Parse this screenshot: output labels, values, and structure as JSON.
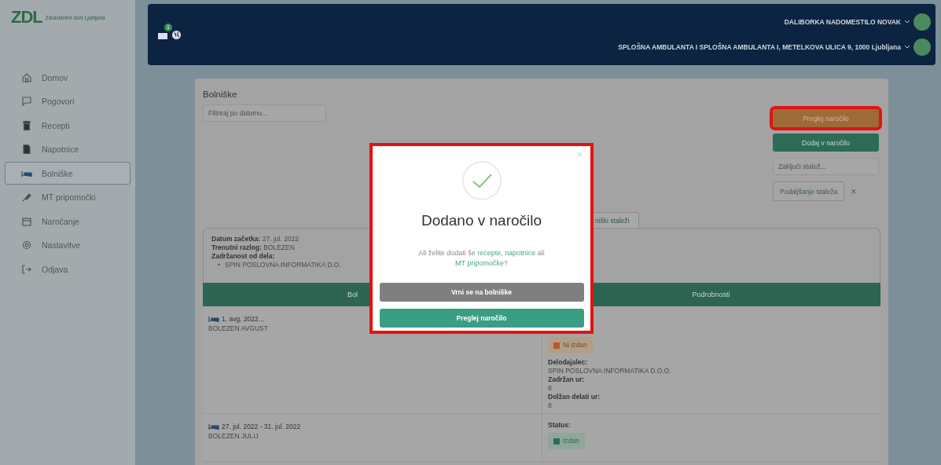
{
  "logo": {
    "mark": "ZDL",
    "name": "Zdravstveni dom Ljubljana"
  },
  "sidebar": {
    "items": [
      {
        "label": "Domov",
        "selected": false
      },
      {
        "label": "Pogovori",
        "selected": false
      },
      {
        "label": "Recepti",
        "selected": false
      },
      {
        "label": "Napotnice",
        "selected": false
      },
      {
        "label": "Bolniške",
        "selected": true
      },
      {
        "label": "MT pripomočki",
        "selected": false
      },
      {
        "label": "Naročanje",
        "selected": false
      },
      {
        "label": "Nastavitve",
        "selected": false
      },
      {
        "label": "Odjava",
        "selected": false
      }
    ]
  },
  "header": {
    "notification_count": "1",
    "user": "DALIBORKA NADOMESTILO NOVAK",
    "location": "SPLOŠNA AMBULANTA I SPLOŠNA AMBULANTA I, METELKOVA ULICA 9, 1000 Ljubljana"
  },
  "page": {
    "title": "Bolniške",
    "filter": {
      "placeholder": "Filtriraj po datumu..."
    },
    "actions": [
      {
        "label": "Preglej naročilo",
        "kind": "warning",
        "highlighted": true
      },
      {
        "label": "Dodaj v naročilo",
        "kind": "primary",
        "highlighted": false
      }
    ],
    "end_field": {
      "placeholder": "Zaključi stalež..."
    },
    "extend_button": "Podaljšanje staleža",
    "clear_button": "×"
  },
  "tabs": [
    {
      "label": "niški staleži",
      "selected": true
    }
  ],
  "summary": [
    {
      "label": "Datum začetka:",
      "value": "27. jul. 2022"
    },
    {
      "label": "Trenutni razlog:",
      "value": "BOLEZEN"
    },
    {
      "label": "Zadržanost od dela:"
    }
  ],
  "summary_list": [
    {
      "marker": "•",
      "text": "SPIN POSLOVNA INFORMATIKA D.O."
    }
  ],
  "table": {
    "columns": [
      "Bol",
      "Podrobnosti"
    ],
    "rows": [
      {
        "period": "1. avg. 2022...",
        "reason": "BOLEZEN AVGUST",
        "status": {
          "kind": "pending",
          "label": "Ni izdan"
        },
        "fields": [
          {
            "label": "Delodajalec:",
            "value": "SPIN POSLOVNA INFORMATIKA D.O.O."
          },
          {
            "label": "Zadržan ur:",
            "value": "8"
          },
          {
            "label": "Dolžan delati ur:",
            "value": "8"
          }
        ]
      },
      {
        "period": "27. jul. 2022 - 31. jul. 2022",
        "reason": "BOLEZEN JULIJ",
        "status_label": "Status:",
        "status": {
          "kind": "issued",
          "label": "Izdan"
        },
        "fields": []
      }
    ]
  },
  "modal": {
    "title": "Dodano v naročilo",
    "close": "×",
    "message": [
      {
        "text": "Ali želite dodati še ",
        "kind": "text"
      },
      {
        "text": "recepte",
        "kind": "link"
      },
      {
        "text": ", ",
        "kind": "text"
      },
      {
        "text": "napotnice",
        "kind": "link"
      },
      {
        "text": " ali ",
        "kind": "text"
      },
      {
        "text": "MT pripomočke",
        "kind": "link"
      },
      {
        "text": "?",
        "kind": "text"
      }
    ],
    "buttons": [
      {
        "label": "Vrni se na bolniške",
        "kind": "secondary"
      },
      {
        "label": "Preglej naročilo",
        "kind": "primary"
      }
    ],
    "highlighted": true
  }
}
